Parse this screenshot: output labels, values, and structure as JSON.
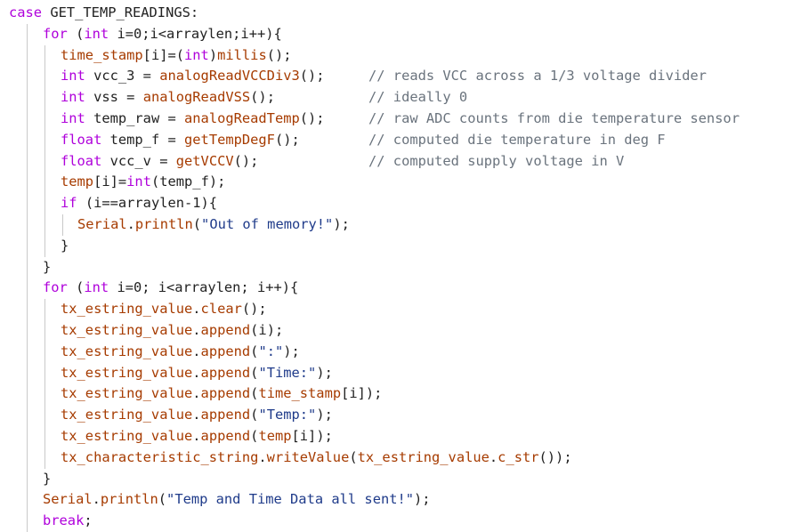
{
  "colors": {
    "keyword": "#af00db",
    "function": "#a63b00",
    "comment": "#6a737d",
    "plain": "#222222",
    "string": "#1f3b8a"
  },
  "lines": [
    [
      {
        "t": "case",
        "c": "keyword"
      },
      {
        "t": " GET_TEMP_READINGS:",
        "c": "plain"
      }
    ],
    [
      {
        "t": "for",
        "c": "keyword"
      },
      {
        "t": " (",
        "c": "plain"
      },
      {
        "t": "int",
        "c": "keyword"
      },
      {
        "t": " i=0;i<arraylen;i++){",
        "c": "plain"
      }
    ],
    [
      {
        "t": "time_stamp",
        "c": "function"
      },
      {
        "t": "[i]=(",
        "c": "plain"
      },
      {
        "t": "int",
        "c": "keyword"
      },
      {
        "t": ")",
        "c": "plain"
      },
      {
        "t": "millis",
        "c": "function"
      },
      {
        "t": "();",
        "c": "plain"
      }
    ],
    [
      {
        "t": "int",
        "c": "keyword"
      },
      {
        "t": " vcc_3 = ",
        "c": "plain"
      },
      {
        "t": "analogReadVCCDiv3",
        "c": "function"
      },
      {
        "t": "();",
        "c": "plain"
      }
    ],
    [
      {
        "t": "int",
        "c": "keyword"
      },
      {
        "t": " vss = ",
        "c": "plain"
      },
      {
        "t": "analogReadVSS",
        "c": "function"
      },
      {
        "t": "();",
        "c": "plain"
      }
    ],
    [
      {
        "t": "int",
        "c": "keyword"
      },
      {
        "t": " temp_raw = ",
        "c": "plain"
      },
      {
        "t": "analogReadTemp",
        "c": "function"
      },
      {
        "t": "();",
        "c": "plain"
      }
    ],
    [
      {
        "t": "float",
        "c": "keyword"
      },
      {
        "t": " temp_f = ",
        "c": "plain"
      },
      {
        "t": "getTempDegF",
        "c": "function"
      },
      {
        "t": "();",
        "c": "plain"
      }
    ],
    [
      {
        "t": "float",
        "c": "keyword"
      },
      {
        "t": " vcc_v = ",
        "c": "plain"
      },
      {
        "t": "getVCCV",
        "c": "function"
      },
      {
        "t": "();",
        "c": "plain"
      }
    ],
    [
      {
        "t": "temp",
        "c": "function"
      },
      {
        "t": "[i]=",
        "c": "plain"
      },
      {
        "t": "int",
        "c": "keyword"
      },
      {
        "t": "(temp_f);",
        "c": "plain"
      }
    ],
    [
      {
        "t": "if",
        "c": "keyword"
      },
      {
        "t": " (i==arraylen-1){",
        "c": "plain"
      }
    ],
    [
      {
        "t": "Serial",
        "c": "function"
      },
      {
        "t": ".",
        "c": "plain"
      },
      {
        "t": "println",
        "c": "function"
      },
      {
        "t": "(",
        "c": "plain"
      },
      {
        "t": "\"Out of memory!\"",
        "c": "string"
      },
      {
        "t": ");",
        "c": "plain"
      }
    ],
    [
      {
        "t": "}",
        "c": "plain"
      }
    ],
    [
      {
        "t": "}",
        "c": "plain"
      }
    ],
    [
      {
        "t": "for",
        "c": "keyword"
      },
      {
        "t": " (",
        "c": "plain"
      },
      {
        "t": "int",
        "c": "keyword"
      },
      {
        "t": " i=0; i<arraylen; i++){",
        "c": "plain"
      }
    ],
    [
      {
        "t": "tx_estring_value",
        "c": "function"
      },
      {
        "t": ".",
        "c": "plain"
      },
      {
        "t": "clear",
        "c": "function"
      },
      {
        "t": "();",
        "c": "plain"
      }
    ],
    [
      {
        "t": "tx_estring_value",
        "c": "function"
      },
      {
        "t": ".",
        "c": "plain"
      },
      {
        "t": "append",
        "c": "function"
      },
      {
        "t": "(i);",
        "c": "plain"
      }
    ],
    [
      {
        "t": "tx_estring_value",
        "c": "function"
      },
      {
        "t": ".",
        "c": "plain"
      },
      {
        "t": "append",
        "c": "function"
      },
      {
        "t": "(",
        "c": "plain"
      },
      {
        "t": "\":\"",
        "c": "string"
      },
      {
        "t": ");",
        "c": "plain"
      }
    ],
    [
      {
        "t": "tx_estring_value",
        "c": "function"
      },
      {
        "t": ".",
        "c": "plain"
      },
      {
        "t": "append",
        "c": "function"
      },
      {
        "t": "(",
        "c": "plain"
      },
      {
        "t": "\"Time:\"",
        "c": "string"
      },
      {
        "t": ");",
        "c": "plain"
      }
    ],
    [
      {
        "t": "tx_estring_value",
        "c": "function"
      },
      {
        "t": ".",
        "c": "plain"
      },
      {
        "t": "append",
        "c": "function"
      },
      {
        "t": "(",
        "c": "plain"
      },
      {
        "t": "time_stamp",
        "c": "function"
      },
      {
        "t": "[i]);",
        "c": "plain"
      }
    ],
    [
      {
        "t": "tx_estring_value",
        "c": "function"
      },
      {
        "t": ".",
        "c": "plain"
      },
      {
        "t": "append",
        "c": "function"
      },
      {
        "t": "(",
        "c": "plain"
      },
      {
        "t": "\"Temp:\"",
        "c": "string"
      },
      {
        "t": ");",
        "c": "plain"
      }
    ],
    [
      {
        "t": "tx_estring_value",
        "c": "function"
      },
      {
        "t": ".",
        "c": "plain"
      },
      {
        "t": "append",
        "c": "function"
      },
      {
        "t": "(",
        "c": "plain"
      },
      {
        "t": "temp",
        "c": "function"
      },
      {
        "t": "[i]);",
        "c": "plain"
      }
    ],
    [
      {
        "t": "tx_characteristic_string",
        "c": "function"
      },
      {
        "t": ".",
        "c": "plain"
      },
      {
        "t": "writeValue",
        "c": "function"
      },
      {
        "t": "(",
        "c": "plain"
      },
      {
        "t": "tx_estring_value",
        "c": "function"
      },
      {
        "t": ".",
        "c": "plain"
      },
      {
        "t": "c_str",
        "c": "function"
      },
      {
        "t": "());",
        "c": "plain"
      }
    ],
    [
      {
        "t": "}",
        "c": "plain"
      }
    ],
    [
      {
        "t": "Serial",
        "c": "function"
      },
      {
        "t": ".",
        "c": "plain"
      },
      {
        "t": "println",
        "c": "function"
      },
      {
        "t": "(",
        "c": "plain"
      },
      {
        "t": "\"Temp and Time Data all sent!\"",
        "c": "string"
      },
      {
        "t": ");",
        "c": "plain"
      }
    ],
    [
      {
        "t": "break",
        "c": "keyword"
      },
      {
        "t": ";",
        "c": "plain"
      }
    ]
  ],
  "comments": [
    {
      "line": 3,
      "text": "// reads VCC across a 1/3 voltage divider"
    },
    {
      "line": 4,
      "text": "// ideally 0"
    },
    {
      "line": 5,
      "text": "// raw ADC counts from die temperature sensor"
    },
    {
      "line": 6,
      "text": "// computed die temperature in deg F"
    },
    {
      "line": 7,
      "text": "// computed supply voltage in V"
    }
  ]
}
